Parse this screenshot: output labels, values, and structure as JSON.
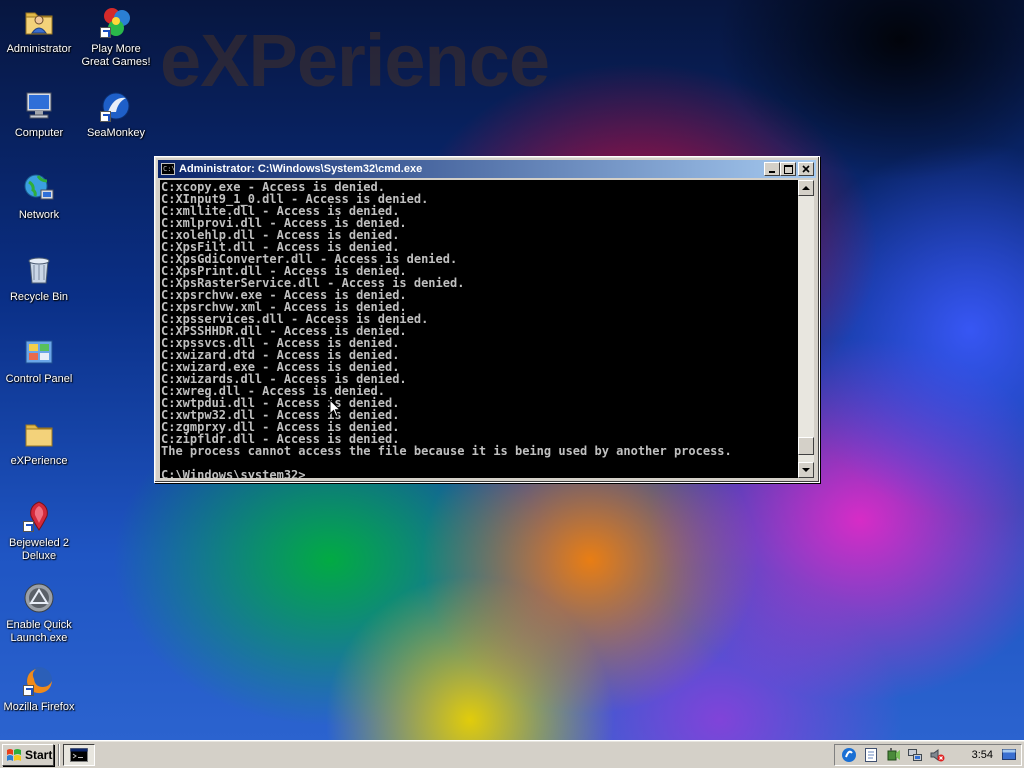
{
  "wallpaper": {
    "brand_text": "eXPerience"
  },
  "desktop": {
    "icons": [
      {
        "id": "administrator",
        "label": "Administrator",
        "icon": "user-folder-icon"
      },
      {
        "id": "play-more-games",
        "label": "Play More\nGreat Games!",
        "icon": "games-icon"
      },
      {
        "id": "computer",
        "label": "Computer",
        "icon": "computer-icon"
      },
      {
        "id": "seamonkey",
        "label": "SeaMonkey",
        "icon": "seamonkey-icon"
      },
      {
        "id": "network",
        "label": "Network",
        "icon": "network-icon"
      },
      {
        "id": "recycle-bin",
        "label": "Recycle Bin",
        "icon": "recycle-bin-icon"
      },
      {
        "id": "control-panel",
        "label": "Control Panel",
        "icon": "control-panel-icon"
      },
      {
        "id": "experience",
        "label": "eXPerience",
        "icon": "folder-icon"
      },
      {
        "id": "bejeweled",
        "label": "Bejeweled 2\nDeluxe",
        "icon": "bejeweled-icon"
      },
      {
        "id": "quick-launch",
        "label": "Enable Quick\nLaunch.exe",
        "icon": "quick-launch-icon"
      },
      {
        "id": "firefox",
        "label": "Mozilla Firefox",
        "icon": "firefox-icon"
      }
    ]
  },
  "cmd_window": {
    "title": "Administrator: C:\\Windows\\System32\\cmd.exe",
    "icon_text": "C:\\",
    "output_lines": [
      "C:xcopy.exe - Access is denied.",
      "C:XInput9_1_0.dll - Access is denied.",
      "C:xmllite.dll - Access is denied.",
      "C:xmlprovi.dll - Access is denied.",
      "C:xolehlp.dll - Access is denied.",
      "C:XpsFilt.dll - Access is denied.",
      "C:XpsGdiConverter.dll - Access is denied.",
      "C:XpsPrint.dll - Access is denied.",
      "C:XpsRasterService.dll - Access is denied.",
      "C:xpsrchvw.exe - Access is denied.",
      "C:xpsrchvw.xml - Access is denied.",
      "C:xpsservices.dll - Access is denied.",
      "C:XPSSHHDR.dll - Access is denied.",
      "C:xpssvcs.dll - Access is denied.",
      "C:xwizard.dtd - Access is denied.",
      "C:xwizard.exe - Access is denied.",
      "C:xwizards.dll - Access is denied.",
      "C:xwreg.dll - Access is denied.",
      "C:xwtpdui.dll - Access is denied.",
      "C:xwtpw32.dll - Access is denied.",
      "C:zgmprxy.dll - Access is denied.",
      "C:zipfldr.dll - Access is denied.",
      "The process cannot access the file because it is being used by another process.",
      ""
    ],
    "prompt": "C:\\Windows\\system32>",
    "scroll_position": 0.97
  },
  "taskbar": {
    "start_label": "Start",
    "clock": "3:54",
    "tray_icons": [
      "skype-icon",
      "notepad-icon",
      "power-icon",
      "network-icon",
      "volume-muted-icon"
    ]
  },
  "colors": {
    "terminal_bg": "#000000",
    "terminal_fg": "#c0c0c0",
    "titlebar_start": "#0a246a",
    "titlebar_end": "#a6caf0",
    "chrome": "#d4d0c8"
  }
}
